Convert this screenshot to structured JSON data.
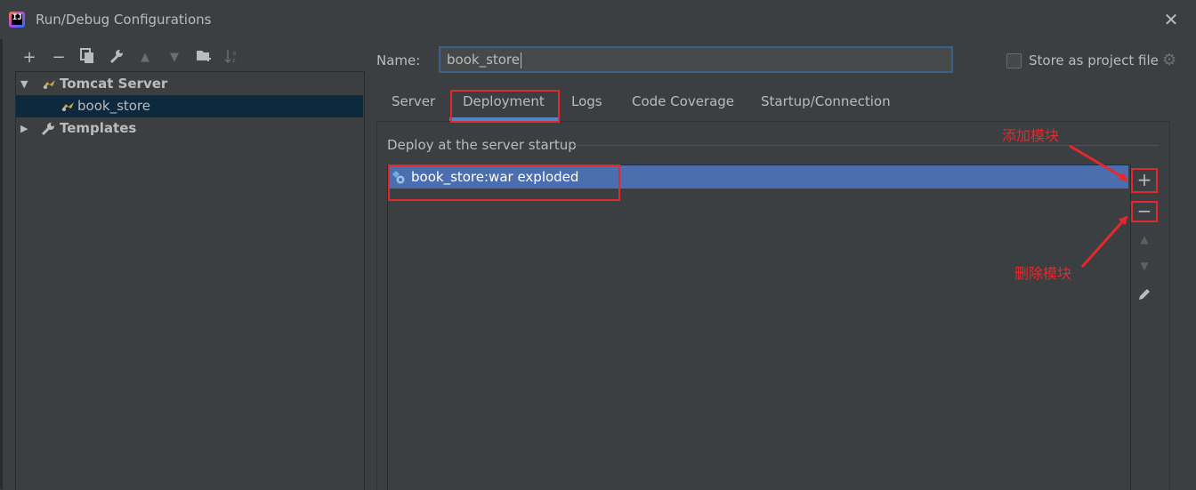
{
  "window": {
    "title": "Run/Debug Configurations"
  },
  "left_toolbar": {
    "icons": [
      "add-icon",
      "remove-icon",
      "copy-icon",
      "wrench-icon",
      "move-up-icon",
      "move-down-icon",
      "new-folder-icon",
      "sort-icon"
    ]
  },
  "tree": {
    "groups": [
      {
        "label": "Tomcat Server",
        "expanded": true,
        "children": [
          {
            "label": "book_store",
            "selected": true
          }
        ]
      },
      {
        "label": "Templates",
        "expanded": false
      }
    ]
  },
  "config": {
    "name_label": "Name:",
    "name_value": "book_store",
    "store_label": "Store as project file",
    "store_checked": false
  },
  "tabs": [
    {
      "label": "Server"
    },
    {
      "label": "Deployment",
      "active": true
    },
    {
      "label": "Logs"
    },
    {
      "label": "Code Coverage"
    },
    {
      "label": "Startup/Connection"
    }
  ],
  "deployment": {
    "group_label": "Deploy at the server startup",
    "items": [
      {
        "label": "book_store:war exploded",
        "selected": true
      }
    ],
    "side_buttons": [
      "add-icon",
      "remove-icon",
      "move-up-icon",
      "move-down-icon",
      "edit-icon"
    ]
  },
  "annotations": {
    "add_module": "添加模块",
    "remove_module": "删除模块",
    "color": "#e8272c"
  },
  "colors": {
    "background": "#3c3f41",
    "selection": "#4b6eaf",
    "tree_selection": "#0d293e",
    "tab_underline": "#4a88c7",
    "input_border": "#3d6185"
  }
}
